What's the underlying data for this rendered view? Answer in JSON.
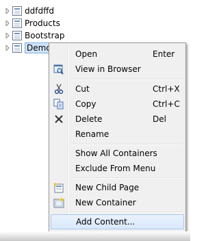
{
  "tree": {
    "items": [
      {
        "label": "ddfdffd"
      },
      {
        "label": "Products"
      },
      {
        "label": "Bootstrap"
      },
      {
        "label": "Demo"
      }
    ]
  },
  "context_menu": {
    "open": {
      "label": "Open",
      "shortcut": "Enter"
    },
    "view_in_browser": {
      "label": "View in Browser"
    },
    "cut": {
      "label": "Cut",
      "shortcut": "Ctrl+X"
    },
    "copy": {
      "label": "Copy",
      "shortcut": "Ctrl+C"
    },
    "delete": {
      "label": "Delete",
      "shortcut": "Del"
    },
    "rename": {
      "label": "Rename"
    },
    "show_all_containers": {
      "label": "Show All Containers"
    },
    "exclude_from_menu": {
      "label": "Exclude From Menu"
    },
    "new_child_page": {
      "label": "New Child Page"
    },
    "new_container": {
      "label": "New Container"
    },
    "add_content": {
      "label": "Add Content..."
    }
  },
  "colors": {
    "selection": "#cfe3fb",
    "highlight": "#d9e8fb",
    "menu_bg": "#f0f0f0"
  }
}
